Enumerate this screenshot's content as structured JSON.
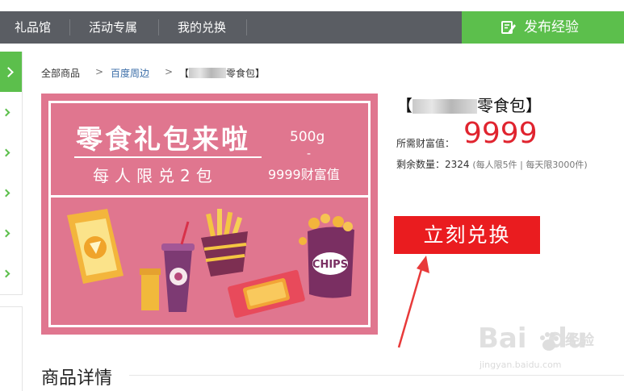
{
  "nav": {
    "items": [
      "礼品馆",
      "活动专属",
      "我的兑换"
    ],
    "publish_label": "发布经验"
  },
  "breadcrumb": {
    "all": "全部商品",
    "sep": ">",
    "category": "百度周边",
    "current_prefix": "【",
    "current_suffix": "零食包】"
  },
  "product_image": {
    "headline": "零食礼包来啦",
    "subline": "每人限兑2包",
    "weight": "500g",
    "dash": "-",
    "cost": "9999财富值",
    "chips_label": "CHIPS"
  },
  "product": {
    "title_prefix": "【",
    "title_suffix": "零食包】",
    "price_label": "所需财富值：",
    "price": "9999",
    "stock_label": "剩余数量：",
    "stock": "2324",
    "limit": "(每人限5件 | 每天限3000件)",
    "redeem_label": "立刻兑换"
  },
  "detail": {
    "heading": "商品详情"
  },
  "watermark": {
    "logo": "Bai",
    "logo_tail": "du",
    "cn": "经验",
    "url": "jingyan.baidu.com"
  },
  "colors": {
    "nav_bg": "#5a5d63",
    "accent_green": "#5cbf4c",
    "price_red": "#e0242f",
    "button_red": "#ea1c1f",
    "banner_pink": "#e0768f"
  },
  "icons": {
    "publish": "edit-icon",
    "side": "chevron-right-icon"
  }
}
